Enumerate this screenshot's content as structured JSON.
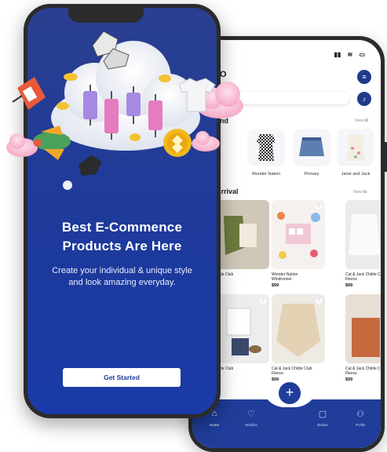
{
  "back_phone": {
    "status": {
      "signal": "▮▮",
      "wifi": "≋",
      "battery": "▭"
    },
    "greeting": "O",
    "greeting_sub": "name.",
    "sections": {
      "brands_title": "and",
      "brands_view_all": "View All",
      "arrivals_title": "Arrival",
      "arrivals_view_all": "View All"
    },
    "brands": [
      {
        "label": "ock"
      },
      {
        "label": "Wonder Nation"
      },
      {
        "label": "Primary"
      },
      {
        "label": "Janie and Jack"
      }
    ],
    "products": [
      {
        "name": "hilde Club",
        "price": ""
      },
      {
        "name": "Wonder Nation\nWindrunner",
        "price": "$99"
      },
      {
        "name": "Cat & Jack Childe Cl\nFleece",
        "price": "$99"
      },
      {
        "name": "hilde Club",
        "price": ""
      },
      {
        "name": "Cat & Jack Childe Club\nFleece",
        "price": "$99"
      },
      {
        "name": "Cat & Jack Childe Cl\nFleece",
        "price": "$99"
      }
    ],
    "tabs": [
      {
        "label": "Home"
      },
      {
        "label": "Wishlist"
      },
      {
        "label": "Basket"
      },
      {
        "label": "Profile"
      }
    ]
  },
  "front_phone": {
    "title_line1": "Best E-Commence",
    "title_line2": "Products Are Here",
    "subtitle": "Create your individual & unique style and look amazing everyday.",
    "cta_label": "Get Started"
  },
  "colors": {
    "brand_blue": "#1f3d99",
    "hero_gradient_top": "#2a3f8f",
    "hero_gradient_bottom": "#1a3aa8"
  }
}
